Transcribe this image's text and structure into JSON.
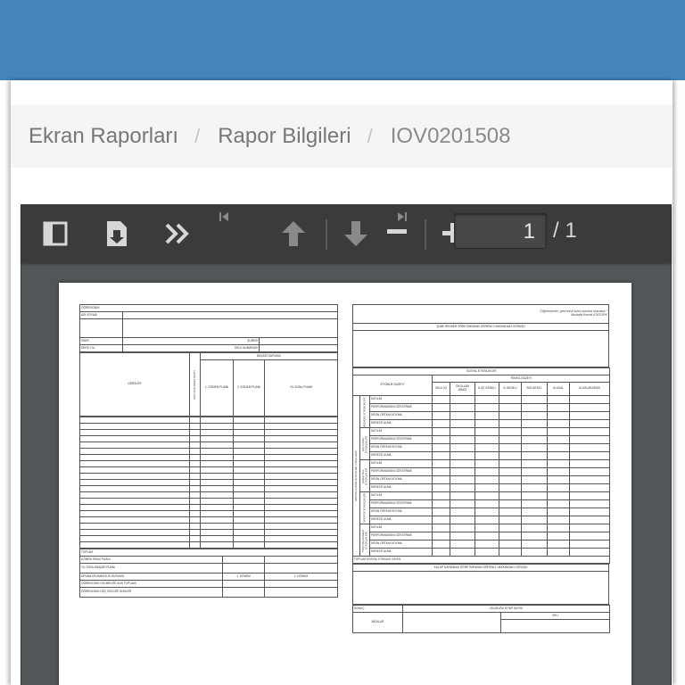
{
  "breadcrumb": {
    "items": [
      "Ekran Raporları",
      "Rapor Bilgileri",
      "IOV0201508"
    ],
    "separator": "/"
  },
  "toolbar": {
    "current_page": "1",
    "total_pages": "/ 1"
  },
  "form": {
    "left": {
      "ogrencinin": "ÖĞRENCİNİN",
      "adi_soyadi": "ADI SOYADI",
      "sinifi": "SINIFI",
      "subesi": "ŞUBESİ",
      "ders_yili": "DERS YILI",
      "okul_numarasi": "OKUL NUMARASI",
      "basari_durumu": "BAŞARI DURUMU",
      "dersler": "DERSLER",
      "haftalik_ders_saati": "HAFTALIK DERS SAATİ",
      "donem1": "1. DÖNEM PUANI",
      "donem2": "2. DÖNEM PUANI",
      "yil_sonu_puani": "YIL SONU PUANI",
      "toplam": "TOPLAM",
      "donem_sonu_puani": "DÖNEM SONU PUANI",
      "yil_sonu_basari_puani": "YIL SONU BAŞARI PUANI",
      "devam_devamsizlik": "DEVAM-DEVAMSIZLIK DURUMU",
      "donem1_short": "1. DÖNEM",
      "donem2_short": "2. DÖNEM",
      "gelmedigi_gun": "ÖĞRENCİNİN GELMEDİĞİ GÜN TOPLAMI",
      "gec_geldigi_gun": "ÖĞRENCİNİN GEÇ GELDİĞİ GÜNLER"
    },
    "right": {
      "quote": "\"Öğretmenler, yeni nesil sizin eseriniz olacaktır.\"",
      "quote_author": "Mustafa Kemal ATATÜRK",
      "sube_gorus": "ŞUBE REHBER ÖĞRETMENİNİN ÖĞRENCİ HAKKINDAKİ GÖRÜŞÜ",
      "sosyal_etkinlikler": "SOSYAL ETKİNLİKLER",
      "temsil_duzeyi": "TEMSİL DÜZEYİ",
      "etkinlik_duzeyi": "ETKİNLİK DÜZEYİ",
      "levels": [
        "OKUL İÇİ",
        "OKULLAR ARASI",
        "İLÇE GENELİ",
        "İL GENELİ",
        "BÖLGESEL",
        "ULUSAL",
        "ULUSLARARASI"
      ],
      "side_label": "SOSYAL ETKİNLİK KATILIMI / ÖDÜLLERİ",
      "groups": [
        "BİLİMSEL ETKİNLİKLER",
        "KÜLTÜREL ETKİNLİKLER",
        "SANATSAL ETKİNLİKLER",
        "SPORTİF ETKİNLİKLER",
        "TOPLUM HİZMETİ ETKİNLİKLERİ"
      ],
      "activities": [
        "KATILIM",
        "PERFORMANSINI GÖSTERME",
        "ÜRÜN ORTAYA KOYMA",
        "DERECE ALMA"
      ],
      "toplam_sosyal": "TOPLAM SOSYAL ETKİNLİK SAYISI",
      "kulup_gorus": "KULÜP DANIŞMAN ÖĞRETMENİNİN ÖĞRENCİ HAKKINDAKİ GÖRÜŞÜ",
      "sonuc": "SONUÇ",
      "okudugu_kitap": "OKUDUĞU KİTAP SAYISI",
      "veli": "VELİ",
      "imzalar": "İMZALAR"
    }
  }
}
